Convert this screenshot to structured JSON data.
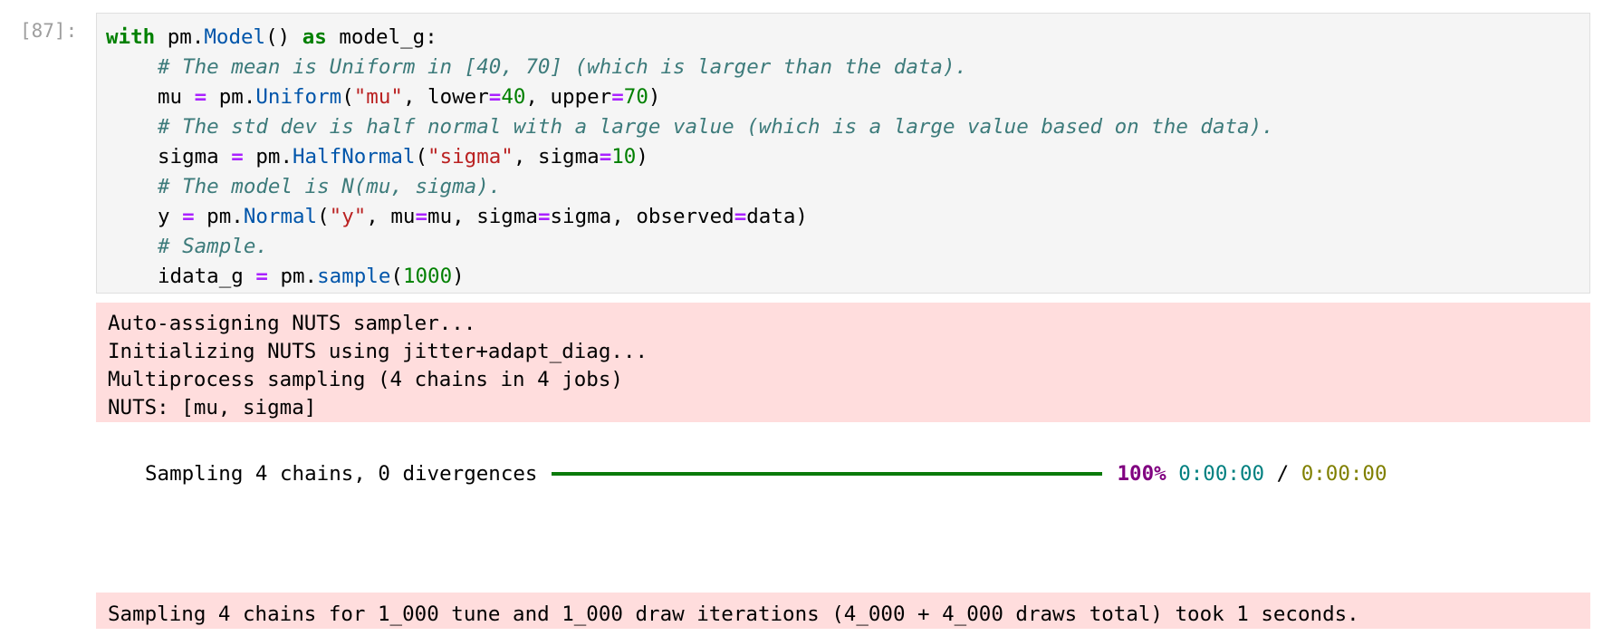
{
  "cell": {
    "prompt": "[87]:",
    "code": {
      "l1": {
        "kw_with": "with",
        "obj": " pm.",
        "fn": "Model",
        "rest": "() ",
        "kw_as": "as",
        "var": " model_g:"
      },
      "l2": {
        "comment": "# The mean is Uniform in [40, 70] (which is larger than the data)."
      },
      "l3": {
        "a": "mu ",
        "eq": "=",
        "b": " pm.",
        "fn": "Uniform",
        "c": "(",
        "s": "\"mu\"",
        "d": ", lower",
        "eq2": "=",
        "n1": "40",
        "e": ", upper",
        "eq3": "=",
        "n2": "70",
        "f": ")"
      },
      "l4": {
        "comment": "# The std dev is half normal with a large value (which is a large value based on the data)."
      },
      "l5": {
        "a": "sigma ",
        "eq": "=",
        "b": " pm.",
        "fn": "HalfNormal",
        "c": "(",
        "s": "\"sigma\"",
        "d": ", sigma",
        "eq2": "=",
        "n1": "10",
        "f": ")"
      },
      "l6": {
        "comment": "# The model is N(mu, sigma)."
      },
      "l7": {
        "a": "y ",
        "eq": "=",
        "b": " pm.",
        "fn": "Normal",
        "c": "(",
        "s": "\"y\"",
        "d": ", mu",
        "eq2": "=",
        "e": "mu, sigma",
        "eq3": "=",
        "g": "sigma, observed",
        "eq4": "=",
        "h": "data)"
      },
      "l8": {
        "comment": "# Sample."
      },
      "l9": {
        "a": "idata_g ",
        "eq": "=",
        "b": " pm.",
        "fn": "sample",
        "c": "(",
        "n1": "1000",
        "f": ")"
      }
    }
  },
  "stderr_top": [
    "Auto-assigning NUTS sampler...",
    "Initializing NUTS using jitter+adapt_diag...",
    "Multiprocess sampling (4 chains in 4 jobs)",
    "NUTS: [mu, sigma]"
  ],
  "progress": {
    "label": "Sampling 4 chains, 0 divergences",
    "fraction": 1.0,
    "percent": "100%",
    "elapsed": "0:00:00",
    "separator": " / ",
    "remaining": "0:00:00"
  },
  "stderr_bottom": "Sampling 4 chains for 1_000 tune and 1_000 draw iterations (4_000 + 4_000 draws total) took 1 seconds."
}
